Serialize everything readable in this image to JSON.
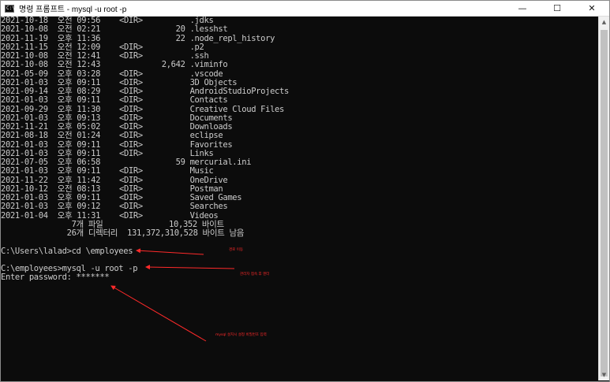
{
  "window": {
    "title": "명령 프롬프트 - mysql  -u root -p",
    "icon_label": "C:\\",
    "controls": {
      "minimize": "—",
      "maximize": "☐",
      "close": "✕"
    }
  },
  "console": {
    "lines": [
      "2021-10-18  오전 09:56    <DIR>          .jdks",
      "2021-10-08  오전 02:21                20 .lesshst",
      "2021-11-19  오후 11:36                22 .node_repl_history",
      "2021-11-15  오전 12:09    <DIR>          .p2",
      "2021-10-08  오전 12:41    <DIR>          .ssh",
      "2021-10-08  오전 12:43             2,642 .viminfo",
      "2021-05-09  오후 03:28    <DIR>          .vscode",
      "2021-01-03  오후 09:11    <DIR>          3D Objects",
      "2021-09-14  오후 08:29    <DIR>          AndroidStudioProjects",
      "2021-01-03  오후 09:11    <DIR>          Contacts",
      "2021-09-29  오후 11:30    <DIR>          Creative Cloud Files",
      "2021-01-03  오후 09:13    <DIR>          Documents",
      "2021-11-21  오후 05:02    <DIR>          Downloads",
      "2021-08-18  오전 01:24    <DIR>          eclipse",
      "2021-01-03  오후 09:11    <DIR>          Favorites",
      "2021-01-03  오후 09:11    <DIR>          Links",
      "2021-07-05  오후 06:58                59 mercurial.ini",
      "2021-01-03  오후 09:11    <DIR>          Music",
      "2021-11-22  오후 11:42    <DIR>          OneDrive",
      "2021-10-12  오전 08:13    <DIR>          Postman",
      "2021-01-03  오후 09:11    <DIR>          Saved Games",
      "2021-01-03  오후 09:12    <DIR>          Searches",
      "2021-01-04  오후 11:31    <DIR>          Videos",
      "               7개 파일              10,352 바이트",
      "              26개 디렉터리  131,372,310,528 바이트 남음",
      "",
      "C:\\Users\\lalad>cd \\employees",
      "",
      "C:\\employees>mysql -u root -p",
      "Enter password: *******"
    ]
  },
  "annotations": [
    {
      "text": "경로 이동"
    },
    {
      "text": "관리자 접속 후 엔터"
    },
    {
      "text": "mysql 설치시 설정 비밀번호 입력"
    }
  ],
  "colors": {
    "console_bg": "#0c0c0c",
    "console_fg": "#cccccc",
    "annotation": "#ff2a2a"
  },
  "scrollbar": {
    "up_icon": "▲",
    "down_icon": "▼"
  }
}
